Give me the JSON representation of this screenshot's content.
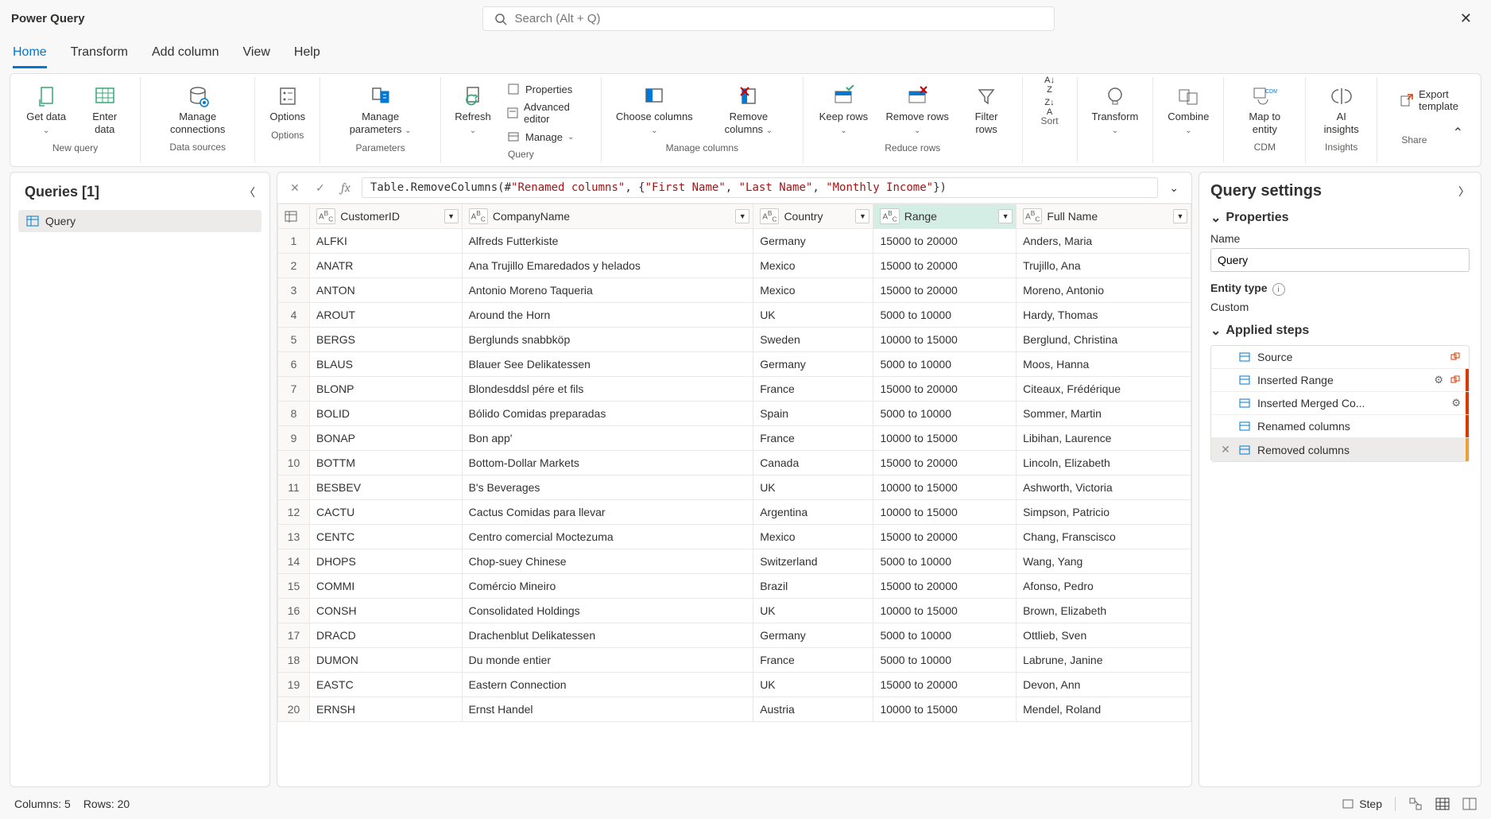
{
  "app_title": "Power Query",
  "search_placeholder": "Search (Alt + Q)",
  "menu": {
    "items": [
      "Home",
      "Transform",
      "Add column",
      "View",
      "Help"
    ],
    "active": 0
  },
  "ribbon": {
    "groups": [
      {
        "label": "New query",
        "buttons": [
          {
            "label": "Get data",
            "dropdown": true
          },
          {
            "label": "Enter data"
          }
        ]
      },
      {
        "label": "Data sources",
        "buttons": [
          {
            "label": "Manage connections"
          }
        ]
      },
      {
        "label": "Options",
        "buttons": [
          {
            "label": "Options"
          }
        ]
      },
      {
        "label": "Parameters",
        "buttons": [
          {
            "label": "Manage parameters",
            "dropdown": true
          }
        ]
      },
      {
        "label": "Query",
        "buttons": [
          {
            "label": "Refresh",
            "dropdown": true
          }
        ],
        "stack": [
          {
            "label": "Properties"
          },
          {
            "label": "Advanced editor"
          },
          {
            "label": "Manage",
            "dropdown": true
          }
        ]
      },
      {
        "label": "Manage columns",
        "buttons": [
          {
            "label": "Choose columns",
            "dropdown": true
          },
          {
            "label": "Remove columns",
            "dropdown": true
          }
        ]
      },
      {
        "label": "Reduce rows",
        "buttons": [
          {
            "label": "Keep rows",
            "dropdown": true
          },
          {
            "label": "Remove rows",
            "dropdown": true
          },
          {
            "label": "Filter rows"
          }
        ]
      },
      {
        "label": "Sort",
        "buttons": [
          {
            "label": "",
            "icon_only": true
          }
        ]
      },
      {
        "label": "",
        "buttons": [
          {
            "label": "Transform",
            "dropdown": true
          }
        ]
      },
      {
        "label": "",
        "buttons": [
          {
            "label": "Combine",
            "dropdown": true
          }
        ]
      },
      {
        "label": "CDM",
        "buttons": [
          {
            "label": "Map to entity"
          }
        ]
      },
      {
        "label": "Insights",
        "buttons": [
          {
            "label": "AI insights"
          }
        ]
      },
      {
        "label": "Share",
        "export": "Export template"
      }
    ]
  },
  "queries": {
    "title": "Queries [1]",
    "items": [
      {
        "name": "Query"
      }
    ]
  },
  "formula": {
    "prefix": "Table.RemoveColumns(#",
    "arg0": "\"Renamed columns\"",
    "mid": ", {",
    "s1": "\"First Name\"",
    "c1": ", ",
    "s2": "\"Last Name\"",
    "c2": ", ",
    "s3": "\"Monthly Income\"",
    "suffix": "})"
  },
  "table": {
    "columns": [
      {
        "name": "CustomerID",
        "type": "ABC"
      },
      {
        "name": "CompanyName",
        "type": "ABC"
      },
      {
        "name": "Country",
        "type": "ABC"
      },
      {
        "name": "Range",
        "type": "ABC",
        "selected": true
      },
      {
        "name": "Full Name",
        "type": "ABC"
      }
    ],
    "rows": [
      [
        "ALFKI",
        "Alfreds Futterkiste",
        "Germany",
        "15000 to 20000",
        "Anders, Maria"
      ],
      [
        "ANATR",
        "Ana Trujillo Emaredados y helados",
        "Mexico",
        "15000 to 20000",
        "Trujillo, Ana"
      ],
      [
        "ANTON",
        "Antonio Moreno Taqueria",
        "Mexico",
        "15000 to 20000",
        "Moreno, Antonio"
      ],
      [
        "AROUT",
        "Around the Horn",
        "UK",
        "5000 to 10000",
        "Hardy, Thomas"
      ],
      [
        "BERGS",
        "Berglunds snabbköp",
        "Sweden",
        "10000 to 15000",
        "Berglund, Christina"
      ],
      [
        "BLAUS",
        "Blauer See Delikatessen",
        "Germany",
        "5000 to 10000",
        "Moos, Hanna"
      ],
      [
        "BLONP",
        "Blondesddsl pére et fils",
        "France",
        "15000 to 20000",
        "Citeaux, Frédérique"
      ],
      [
        "BOLID",
        "Bólido Comidas preparadas",
        "Spain",
        "5000 to 10000",
        "Sommer, Martin"
      ],
      [
        "BONAP",
        "Bon app'",
        "France",
        "10000 to 15000",
        "Libihan, Laurence"
      ],
      [
        "BOTTM",
        "Bottom-Dollar Markets",
        "Canada",
        "15000 to 20000",
        "Lincoln, Elizabeth"
      ],
      [
        "BESBEV",
        "B's Beverages",
        "UK",
        "10000 to 15000",
        "Ashworth, Victoria"
      ],
      [
        "CACTU",
        "Cactus Comidas para llevar",
        "Argentina",
        "10000 to 15000",
        "Simpson, Patricio"
      ],
      [
        "CENTC",
        "Centro comercial Moctezuma",
        "Mexico",
        "15000 to 20000",
        "Chang, Franscisco"
      ],
      [
        "DHOPS",
        "Chop-suey Chinese",
        "Switzerland",
        "5000 to 10000",
        "Wang, Yang"
      ],
      [
        "COMMI",
        "Comércio Mineiro",
        "Brazil",
        "15000 to 20000",
        "Afonso, Pedro"
      ],
      [
        "CONSH",
        "Consolidated Holdings",
        "UK",
        "10000 to 15000",
        "Brown, Elizabeth"
      ],
      [
        "DRACD",
        "Drachenblut Delikatessen",
        "Germany",
        "5000 to 10000",
        "Ottlieb, Sven"
      ],
      [
        "DUMON",
        "Du monde entier",
        "France",
        "5000 to 10000",
        "Labrune, Janine"
      ],
      [
        "EASTC",
        "Eastern Connection",
        "UK",
        "15000 to 20000",
        "Devon, Ann"
      ],
      [
        "ERNSH",
        "Ernst Handel",
        "Austria",
        "10000 to 15000",
        "Mendel, Roland"
      ]
    ]
  },
  "settings": {
    "title": "Query settings",
    "properties_label": "Properties",
    "name_label": "Name",
    "name_value": "Query",
    "entity_type_label": "Entity type",
    "entity_type_value": "Custom",
    "applied_steps_label": "Applied steps",
    "steps": [
      {
        "label": "Source",
        "gear": false,
        "link": true
      },
      {
        "label": "Inserted Range",
        "gear": true,
        "link": true,
        "bar": "orange"
      },
      {
        "label": "Inserted Merged Co...",
        "gear": true,
        "bar": "orange"
      },
      {
        "label": "Renamed columns",
        "bar": "orange"
      },
      {
        "label": "Removed columns",
        "selected": true,
        "deletable": true,
        "bar": "lorange"
      }
    ]
  },
  "statusbar": {
    "columns": "Columns: 5",
    "rows": "Rows: 20",
    "step": "Step"
  }
}
